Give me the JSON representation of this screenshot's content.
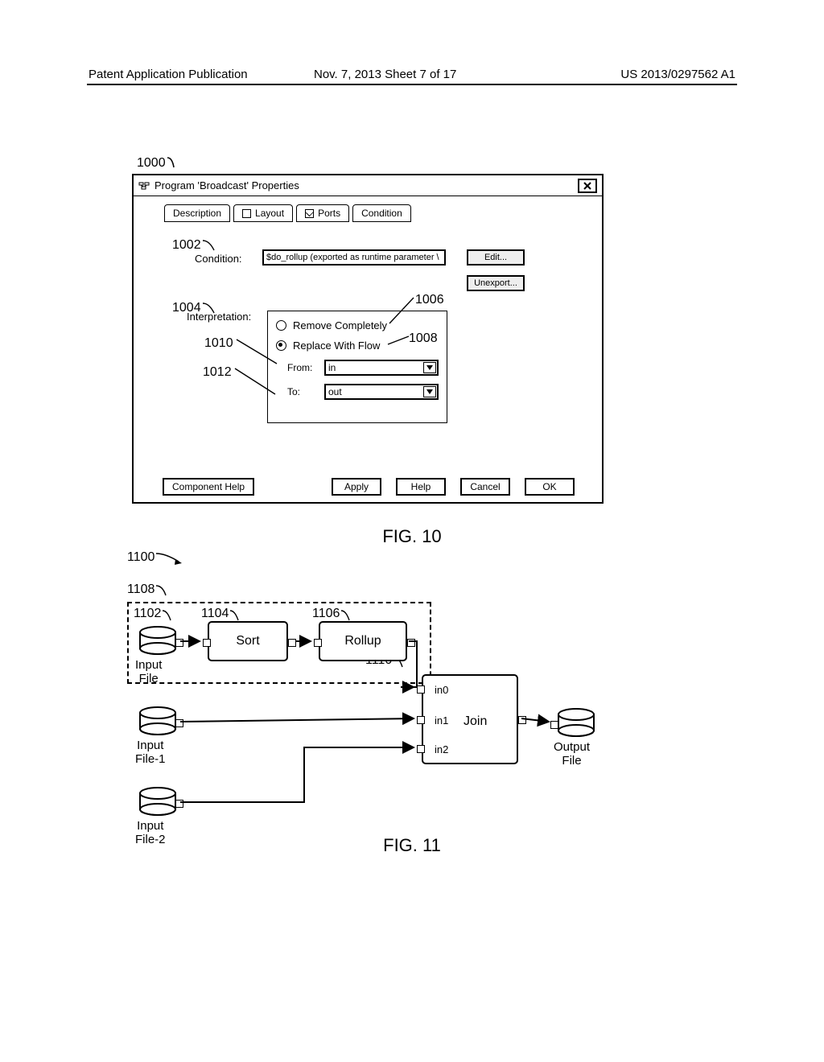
{
  "header": {
    "left": "Patent Application Publication",
    "mid": "Nov. 7, 2013  Sheet 7 of 17",
    "right": "US 2013/0297562 A1"
  },
  "fig10": {
    "ref1000": "1000",
    "title": "Program 'Broadcast' Properties",
    "tabs": {
      "description": "Description",
      "layout": "Layout",
      "ports": "Ports",
      "condition": "Condition"
    },
    "condition_label": "Condition:",
    "condition_value": "$do_rollup (exported as runtime parameter \\",
    "edit": "Edit...",
    "unexport": "Unexport...",
    "interpretation_label": "Interpretation:",
    "opt_remove": "Remove Completely",
    "opt_replace": "Replace With Flow",
    "from_label": "From:",
    "from_val": "in",
    "to_label": "To:",
    "to_val": "out",
    "component_help": "Component Help",
    "apply": "Apply",
    "help": "Help",
    "cancel": "Cancel",
    "ok": "OK",
    "refs": {
      "r1002": "1002",
      "r1004": "1004",
      "r1006": "1006",
      "r1008": "1008",
      "r1010": "1010",
      "r1012": "1012"
    },
    "caption": "FIG. 10"
  },
  "fig11": {
    "ref1100": "1100",
    "ref1108": "1108",
    "nodes": {
      "input_file": "Input\nFile",
      "input_file1": "Input\nFile-1",
      "input_file2": "Input\nFile-2",
      "output_file": "Output\nFile",
      "sort": "Sort",
      "rollup": "Rollup",
      "join": "Join"
    },
    "ports": {
      "in0": "in0",
      "in1": "in1",
      "in2": "in2"
    },
    "refs": {
      "r1102": "1102",
      "r1104": "1104",
      "r1106": "1106",
      "r1110": "1110"
    },
    "caption": "FIG. 11"
  }
}
